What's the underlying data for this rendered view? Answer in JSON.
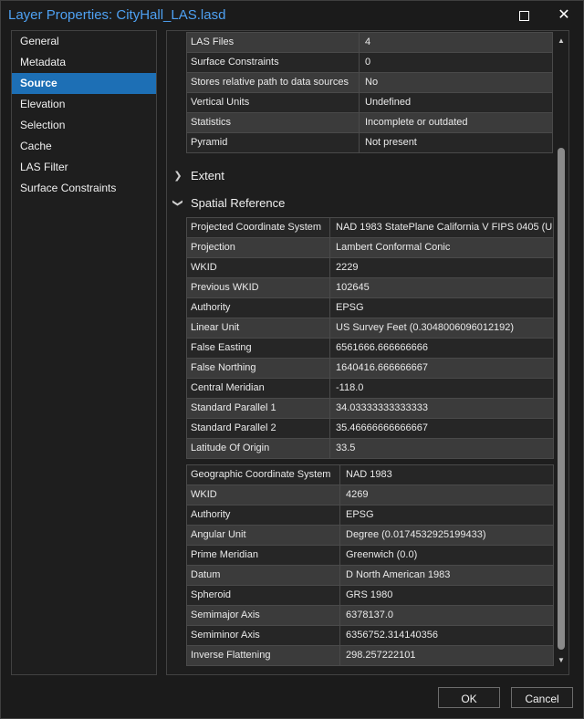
{
  "window": {
    "title": "Layer Properties: CityHall_LAS.lasd",
    "maximize_icon": "maximize-icon",
    "close_icon": "close-icon"
  },
  "nav": {
    "items": [
      {
        "label": "General"
      },
      {
        "label": "Metadata"
      },
      {
        "label": "Source",
        "selected": true
      },
      {
        "label": "Elevation"
      },
      {
        "label": "Selection"
      },
      {
        "label": "Cache"
      },
      {
        "label": "LAS Filter"
      },
      {
        "label": "Surface Constraints"
      }
    ],
    "accent": "#1d6fb5"
  },
  "source_table": [
    {
      "key": "LAS Files",
      "value": "4"
    },
    {
      "key": "Surface Constraints",
      "value": "0"
    },
    {
      "key": "Stores relative path to data sources",
      "value": "No"
    },
    {
      "key": "Vertical Units",
      "value": "Undefined"
    },
    {
      "key": "Statistics",
      "value": "Incomplete or outdated"
    },
    {
      "key": "Pyramid",
      "value": "Not present"
    }
  ],
  "sections": {
    "extent": {
      "label": "Extent",
      "expanded": false,
      "icon": "chevron-right-icon"
    },
    "spatial_reference": {
      "label": "Spatial Reference",
      "expanded": true,
      "icon": "chevron-down-icon"
    }
  },
  "projected_table": [
    {
      "key": "Projected Coordinate System",
      "value": "NAD 1983 StatePlane California V FIPS 0405 (U"
    },
    {
      "key": "Projection",
      "value": "Lambert Conformal Conic"
    },
    {
      "key": "WKID",
      "value": "2229"
    },
    {
      "key": "Previous WKID",
      "value": "102645"
    },
    {
      "key": "Authority",
      "value": "EPSG"
    },
    {
      "key": "Linear Unit",
      "value": "US Survey Feet (0.3048006096012192)"
    },
    {
      "key": "False Easting",
      "value": "6561666.666666666"
    },
    {
      "key": "False Northing",
      "value": "1640416.666666667"
    },
    {
      "key": "Central Meridian",
      "value": "-118.0"
    },
    {
      "key": "Standard Parallel 1",
      "value": "34.03333333333333"
    },
    {
      "key": "Standard Parallel 2",
      "value": "35.46666666666667"
    },
    {
      "key": "Latitude Of Origin",
      "value": "33.5"
    }
  ],
  "geographic_table": [
    {
      "key": "Geographic Coordinate System",
      "value": "NAD 1983"
    },
    {
      "key": "WKID",
      "value": "4269"
    },
    {
      "key": "Authority",
      "value": "EPSG"
    },
    {
      "key": "Angular Unit",
      "value": "Degree (0.0174532925199433)"
    },
    {
      "key": "Prime Meridian",
      "value": "Greenwich (0.0)"
    },
    {
      "key": "Datum",
      "value": "D North American 1983"
    },
    {
      "key": "Spheroid",
      "value": "GRS 1980"
    },
    {
      "key": "Semimajor Axis",
      "value": "6378137.0"
    },
    {
      "key": "Semiminor Axis",
      "value": "6356752.314140356"
    },
    {
      "key": "Inverse Flattening",
      "value": "298.257222101"
    }
  ],
  "scrollbar": {
    "up_icon": "scroll-up-arrow-icon",
    "down_icon": "scroll-down-arrow-icon"
  },
  "buttons": {
    "ok": "OK",
    "cancel": "Cancel"
  }
}
